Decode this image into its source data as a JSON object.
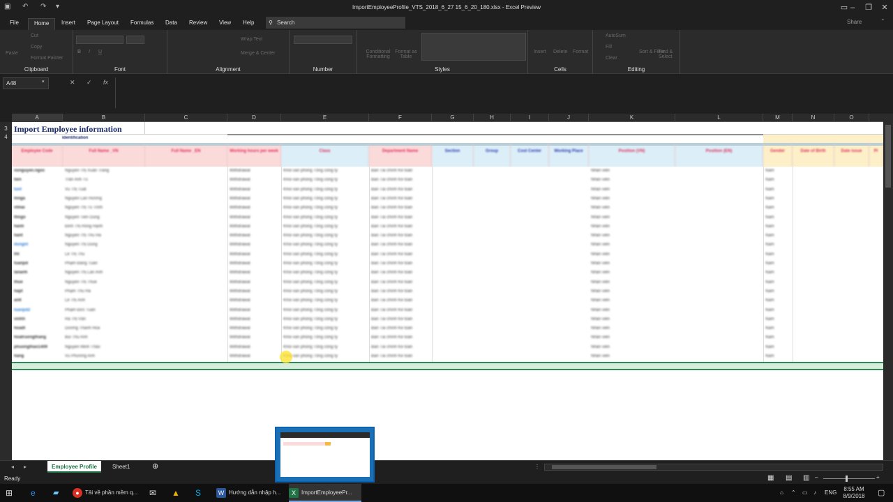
{
  "window": {
    "title": "ImportEmployeeProfile_VTS_2018_6_27 15_6_20_180.xlsx  -  Excel Preview",
    "share_label": "Share"
  },
  "menu": {
    "tabs": [
      "File",
      "Home",
      "Insert",
      "Page Layout",
      "Formulas",
      "Data",
      "Review",
      "View",
      "Help"
    ],
    "active": "Home",
    "search_placeholder": "Search"
  },
  "ribbon": {
    "clipboard": {
      "label": "Clipboard",
      "paste": "Paste",
      "cut": "Cut",
      "copy": "Copy",
      "format_painter": "Format Painter"
    },
    "font": {
      "label": "Font"
    },
    "alignment": {
      "label": "Alignment",
      "wrap_text": "Wrap Text",
      "merge_center": "Merge & Center"
    },
    "number": {
      "label": "Number"
    },
    "styles": {
      "label": "Styles",
      "conditional": "Conditional Formatting",
      "format_table": "Format as Table"
    },
    "cells": {
      "label": "Cells",
      "insert": "Insert",
      "delete": "Delete",
      "format": "Format"
    },
    "editing": {
      "label": "Editing",
      "autosum": "AutoSum",
      "fill": "Fill",
      "clear": "Clear",
      "sort_filter": "Sort & Filter",
      "find_select": "Find & Select"
    }
  },
  "formula_bar": {
    "name_box": "A48",
    "fx": "fx",
    "value": ""
  },
  "sheet": {
    "columns": [
      "A",
      "B",
      "C",
      "D",
      "E",
      "F",
      "G",
      "H",
      "I",
      "J",
      "K",
      "L",
      "M",
      "N",
      "O"
    ],
    "title": "Import Employee information",
    "identification_label": "Identification",
    "headers": [
      "Employee Code",
      "Full Name _VN",
      "Full Name _EN",
      "Working hours per week",
      "Class",
      "Department Name",
      "Section",
      "Group",
      "Cost Center",
      "Working Place",
      "Position (VN)",
      "Position (EN)",
      "Gender",
      "Date of Birth",
      "Date issue",
      "Pl"
    ],
    "row_numbers": [
      "3",
      "4"
    ],
    "rows": [
      [
        "nxnguyen.ngoc",
        "Nguyễn Thị Xuân Trang",
        "Withdrawal",
        "Khối văn phòng Tổng công ty",
        "Ban Tài chính Kế toán",
        "Nhân viên",
        "Nam"
      ],
      [
        "tien",
        "Trần Anh Tú",
        "Withdrawal",
        "Khối văn phòng Tổng công ty",
        "Ban Tài chính Kế toán",
        "Nhân viên",
        "Nam"
      ],
      [
        "tuvt",
        "Vũ Thị Tuất",
        "Withdrawal",
        "Khối văn phòng Tổng công ty",
        "Ban Tài chính Kế toán",
        "Nhân viên",
        "Nam"
      ],
      [
        "lnnga",
        "Nguyễn Lan Hương",
        "Withdrawal",
        "Khối văn phòng Tổng công ty",
        "Ban Tài chính Kế toán",
        "Nhân viên",
        "Nam"
      ],
      [
        "vtmai",
        "Nguyễn Thị Tú Trinh",
        "Withdrawal",
        "Khối văn phòng Tổng công ty",
        "Ban Tài chính Kế toán",
        "Nhân viên",
        "Nam"
      ],
      [
        "thngo",
        "Nguyễn Tiến Dũng",
        "Withdrawal",
        "Khối văn phòng Tổng công ty",
        "Ban Tài chính Kế toán",
        "Nhân viên",
        "Nam"
      ],
      [
        "hanh",
        "Đinh Thị Hồng Hạnh",
        "Withdrawal",
        "Khối văn phòng Tổng công ty",
        "Ban Tài chính Kế toán",
        "Nhân viên",
        "Nam"
      ],
      [
        "hant",
        "Nguyễn Thị Thu Hà",
        "Withdrawal",
        "Khối văn phòng Tổng công ty",
        "Ban Tài chính Kế toán",
        "Nhân viên",
        "Nam"
      ],
      [
        "dungnt",
        "Nguyễn Thị Dung",
        "Withdrawal",
        "Khối văn phòng Tổng công ty",
        "Ban Tài chính Kế toán",
        "Nhân viên",
        "Nam"
      ],
      [
        "tht",
        "Lê Thị Thu",
        "Withdrawal",
        "Khối văn phòng Tổng công ty",
        "Ban Tài chính Kế toán",
        "Nhân viên",
        "Nam"
      ],
      [
        "tuanpd",
        "Phạm Đăng Tuấn",
        "Withdrawal",
        "Khối văn phòng Tổng công ty",
        "Ban Tài chính Kế toán",
        "Nhân viên",
        "Nam"
      ],
      [
        "lananh",
        "Nguyễn Thị Lan Anh",
        "Withdrawal",
        "Khối văn phòng Tổng công ty",
        "Ban Tài chính Kế toán",
        "Nhân viên",
        "Nam"
      ],
      [
        "thue",
        "Nguyễn Thị Thuế",
        "Withdrawal",
        "Khối văn phòng Tổng công ty",
        "Ban Tài chính Kế toán",
        "Nhân viên",
        "Nam"
      ],
      [
        "hapt",
        "Phạm Thu Hà",
        "Withdrawal",
        "Khối văn phòng Tổng công ty",
        "Ban Tài chính Kế toán",
        "Nhân viên",
        "Nam"
      ],
      [
        "anlt",
        "Lê Thị Ánh",
        "Withdrawal",
        "Khối văn phòng Tổng công ty",
        "Ban Tài chính Kế toán",
        "Nhân viên",
        "Nam"
      ],
      [
        "tuanpd2",
        "Phạm Đức Tuấn",
        "Withdrawal",
        "Khối văn phòng Tổng công ty",
        "Ban Tài chính Kế toán",
        "Nhân viên",
        "Nam"
      ],
      [
        "vinhh",
        "Hà Thị Vân",
        "Withdrawal",
        "Khối văn phòng Tổng công ty",
        "Ban Tài chính Kế toán",
        "Nhân viên",
        "Nam"
      ],
      [
        "hoadt",
        "Dương Thanh Hoa",
        "Withdrawal",
        "Khối văn phòng Tổng công ty",
        "Ban Tài chính Kế toán",
        "Nhân viên",
        "Nam"
      ],
      [
        "hoatruongthang",
        "Bùi Thu Anh",
        "Withdrawal",
        "Khối văn phòng Tổng công ty",
        "Ban Tài chính Kế toán",
        "Nhân viên",
        "Nam"
      ],
      [
        "phuongthao1409",
        "Nguyễn Minh Thảo",
        "Withdrawal",
        "Khối văn phòng Tổng công ty",
        "Ban Tài chính Kế toán",
        "Nhân viên",
        "Nam"
      ],
      [
        "hang",
        "Vũ Phương Anh",
        "Withdrawal",
        "Khối văn phòng Tổng công ty",
        "Ban Tài chính Kế toán",
        "Nhân viên",
        "Nam"
      ]
    ],
    "link_rows": [
      2,
      8,
      15
    ]
  },
  "sheet_tabs": {
    "tabs": [
      "Employee Profile",
      "Sheet1"
    ],
    "active": "Employee Profile"
  },
  "status": {
    "ready": "Ready"
  },
  "taskbar": {
    "items": [
      "Tải về phần mềm q...",
      "Hướng dẫn nhập h...",
      "ImportEmployeePr..."
    ],
    "lang": "ENG",
    "time": "8:55 AM",
    "date": "8/9/2018"
  },
  "colors": {
    "accent": "#1e7145",
    "header_red": "#e0305a",
    "header_blue": "#2a3bb0",
    "header_bg_red": "#fbdada",
    "header_bg_blue": "#dceef8",
    "header_bg_yellow": "#fdf0c8"
  }
}
